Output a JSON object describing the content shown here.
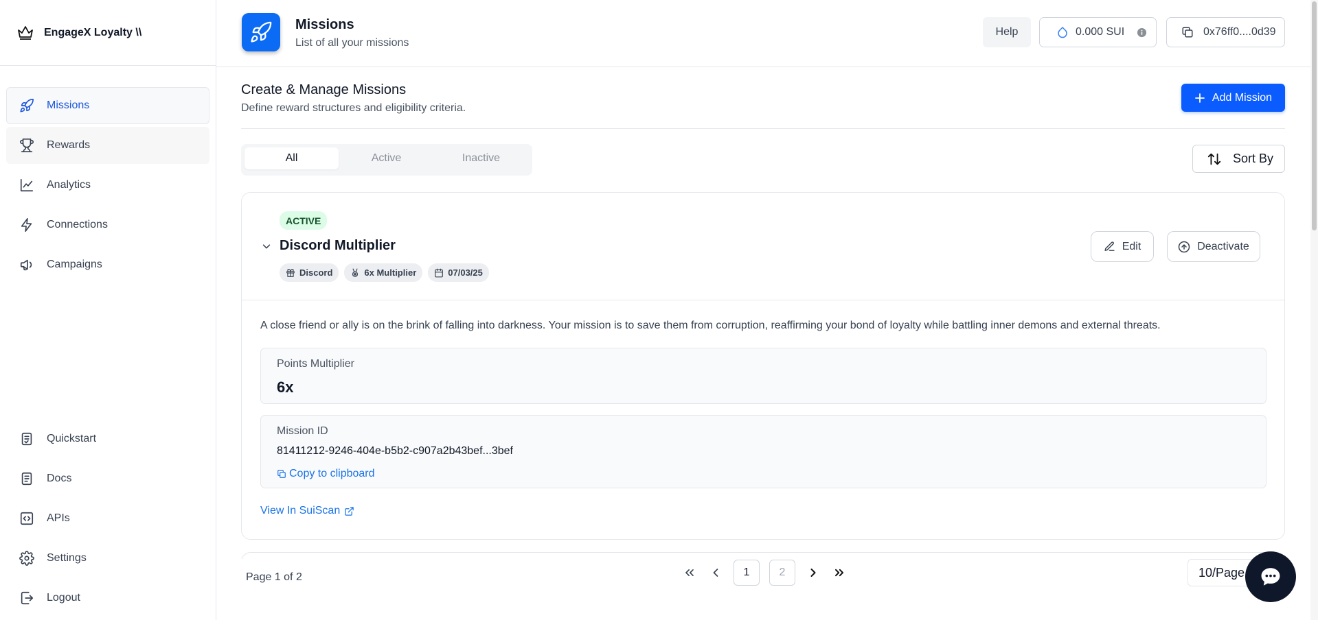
{
  "sidebar": {
    "brand": "EngageX Loyalty \\\\",
    "items": [
      {
        "label": "Missions"
      },
      {
        "label": "Rewards"
      },
      {
        "label": "Analytics"
      },
      {
        "label": "Connections"
      },
      {
        "label": "Campaigns"
      }
    ],
    "bottom_items": [
      {
        "label": "Quickstart"
      },
      {
        "label": "Docs"
      },
      {
        "label": "APIs"
      },
      {
        "label": "Settings"
      },
      {
        "label": "Logout"
      }
    ]
  },
  "header": {
    "title": "Missions",
    "subtitle": "List of all your missions",
    "help": "Help",
    "balance": "0.000 SUI",
    "wallet": "0x76ff0....0d39"
  },
  "main": {
    "title": "Create & Manage Missions",
    "subtitle": "Define reward structures and eligibility criteria.",
    "add_button": "Add Mission",
    "tabs": [
      {
        "label": "All"
      },
      {
        "label": "Active"
      },
      {
        "label": "Inactive"
      }
    ],
    "sort_button": "Sort By"
  },
  "mission": {
    "status": "ACTIVE",
    "title": "Discord Multiplier",
    "tags": [
      {
        "label": "Discord"
      },
      {
        "label": "6x Multiplier"
      },
      {
        "label": "07/03/25"
      }
    ],
    "edit": "Edit",
    "deactivate": "Deactivate",
    "description": "A close friend or ally is on the brink of falling into darkness. Your mission is to save them from corruption, reaffirming your bond of loyalty while battling inner demons and external threats.",
    "multiplier_label": "Points Multiplier",
    "multiplier_value": "6x",
    "id_label": "Mission ID",
    "id_value": "81411212-9246-404e-b5b2-c907a2b43bef...3bef",
    "copy": "Copy to clipboard",
    "view": "View In SuiScan"
  },
  "pagination": {
    "info": "Page 1 of 2",
    "pages": [
      "1",
      "2"
    ],
    "per_page": "10/Page"
  },
  "colors": {
    "accent": "#0b5cff",
    "link": "#1a73e8",
    "active_badge_bg": "#dcfce7"
  }
}
